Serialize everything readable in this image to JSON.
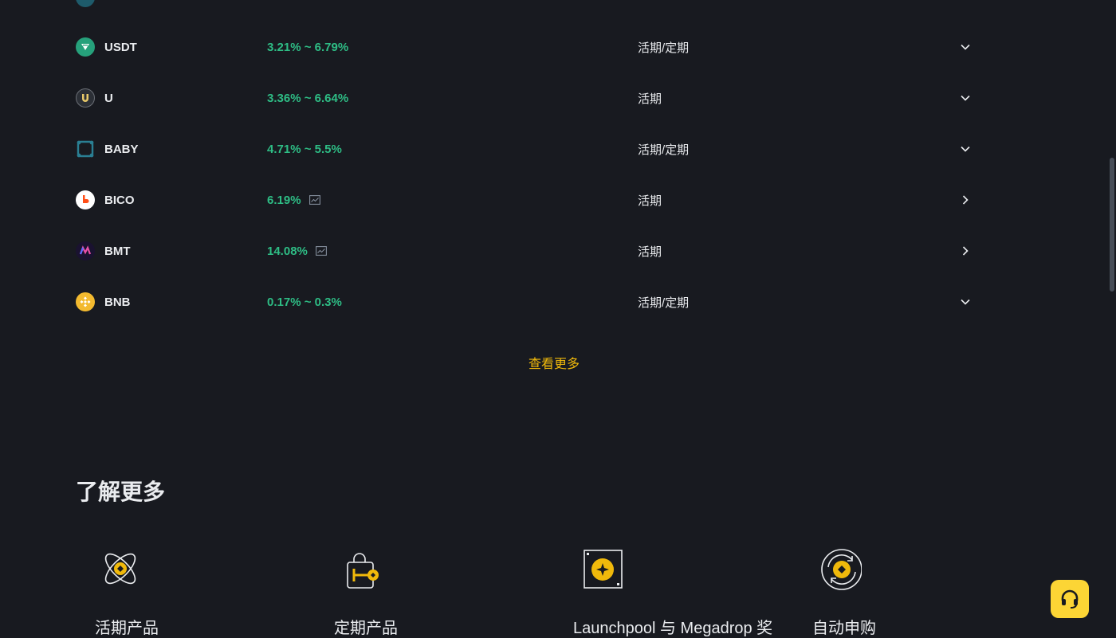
{
  "earn_table": {
    "rows": [
      {
        "name": "USDT",
        "apr": "3.21% ~ 6.79%",
        "type": "活期/定期",
        "icon": "usdt-icon",
        "icon_color": "#26a17b",
        "action": "chevron-down",
        "has_chart": false
      },
      {
        "name": "U",
        "apr": "3.36% ~ 6.64%",
        "type": "活期",
        "icon": "u-token-icon",
        "icon_color": "#2b2f36",
        "action": "chevron-down",
        "has_chart": false
      },
      {
        "name": "BABY",
        "apr": "4.71% ~ 5.5%",
        "type": "活期/定期",
        "icon": "baby-icon",
        "icon_color": "#1e5b6b",
        "action": "chevron-down",
        "has_chart": false
      },
      {
        "name": "BICO",
        "apr": "6.19%",
        "type": "活期",
        "icon": "bico-icon",
        "icon_color": "#ffffff",
        "action": "chevron-right",
        "has_chart": true
      },
      {
        "name": "BMT",
        "apr": "14.08%",
        "type": "活期",
        "icon": "bmt-icon",
        "icon_color": "#1a1230",
        "action": "chevron-right",
        "has_chart": true
      },
      {
        "name": "BNB",
        "apr": "0.17% ~ 0.3%",
        "type": "活期/定期",
        "icon": "bnb-icon",
        "icon_color": "#f3ba2f",
        "action": "chevron-down",
        "has_chart": false
      }
    ],
    "view_more": "查看更多"
  },
  "learn_more": {
    "title": "了解更多",
    "cards": [
      {
        "label": "活期产品",
        "icon": "flexible-product-icon"
      },
      {
        "label": "定期产品",
        "icon": "locked-product-icon"
      },
      {
        "label": "Launchpool 与 Megadrop 奖",
        "icon": "launchpool-icon"
      },
      {
        "label": "自动申购",
        "icon": "auto-subscribe-icon"
      }
    ]
  },
  "colors": {
    "background": "#181a20",
    "apr_green": "#2ebd85",
    "accent_yellow": "#f0b90b",
    "support_button": "#fcd535"
  }
}
